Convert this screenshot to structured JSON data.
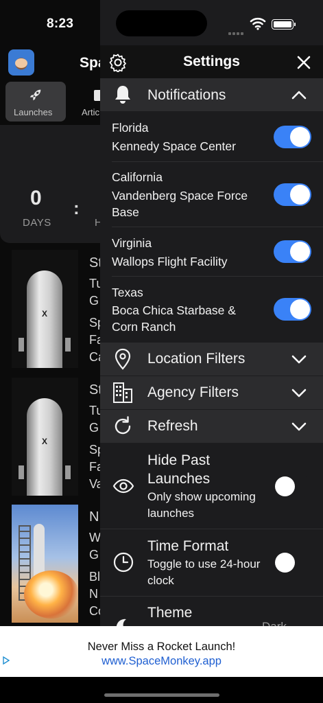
{
  "status_bar": {
    "time": "8:23"
  },
  "background_app": {
    "title": "Spa",
    "tabs": [
      {
        "label": "Launches",
        "icon": "rocket-icon",
        "active": true
      },
      {
        "label": "Artic",
        "icon": "document-icon",
        "active": false
      }
    ],
    "countdown": {
      "days_value": "0",
      "days_label": "DAYS",
      "separator": ":",
      "hours_label": "H"
    },
    "launches": [
      {
        "image": "falcon-9-rocket",
        "lines": [
          "St",
          "Tu",
          "G",
          "Sp",
          "Fa",
          "Ca"
        ]
      },
      {
        "image": "falcon-9-rocket",
        "lines": [
          "St",
          "Tu",
          "G",
          "Sp",
          "Fa",
          "Va"
        ]
      },
      {
        "image": "new-shepard-launch",
        "lines": [
          "N",
          "W",
          "G",
          "Bl",
          "N",
          "Co"
        ]
      }
    ],
    "rocket_logo_text": "X"
  },
  "settings": {
    "title": "Settings",
    "gear_icon": "gear-icon",
    "close_icon": "close-icon",
    "notifications": {
      "label": "Notifications",
      "icon": "bell-icon",
      "expanded": true,
      "items": [
        {
          "region": "Florida",
          "site": "Kennedy Space Center",
          "enabled": true
        },
        {
          "region": "California",
          "site": "Vandenberg Space Force Base",
          "enabled": true
        },
        {
          "region": "Virginia",
          "site": "Wallops Flight Facility",
          "enabled": true
        },
        {
          "region": "Texas",
          "site": "Boca Chica Starbase & Corn Ranch",
          "enabled": true
        }
      ]
    },
    "location_filters": {
      "label": "Location Filters",
      "icon": "map-pin-icon"
    },
    "agency_filters": {
      "label": "Agency Filters",
      "icon": "building-icon"
    },
    "refresh": {
      "label": "Refresh",
      "icon": "refresh-icon"
    },
    "hide_past": {
      "title": "Hide Past Launches",
      "description": "Only show upcoming launches",
      "enabled": false,
      "icon": "eye-icon"
    },
    "time_format": {
      "title": "Time Format",
      "description": "Toggle to use 24-hour clock",
      "enabled": false,
      "icon": "clock-icon"
    },
    "theme": {
      "title": "Theme",
      "value": "Dark",
      "icon": "moon-icon"
    }
  },
  "ad": {
    "headline": "Never Miss a Rocket Launch!",
    "link": "www.SpaceMonkey.app"
  },
  "colors": {
    "accent": "#3a82f7",
    "panel": "#1c1c1e",
    "section": "#2c2c2e"
  }
}
